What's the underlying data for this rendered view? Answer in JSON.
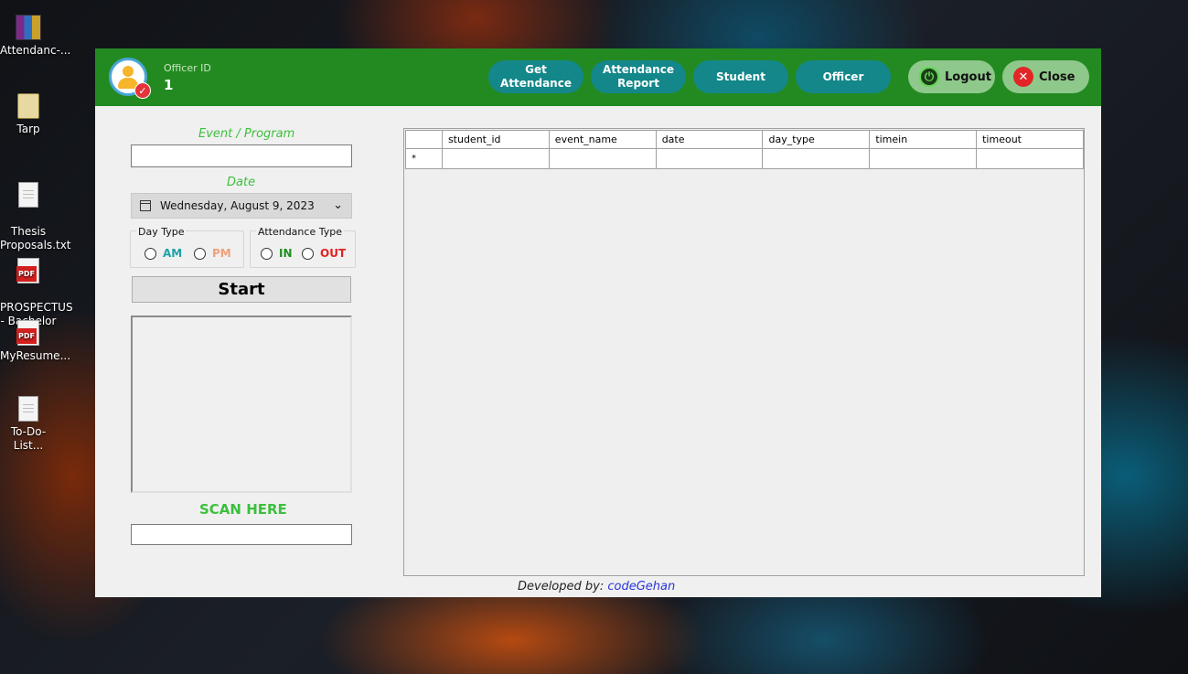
{
  "desktop": {
    "icons": [
      {
        "label": "Attendanc-...",
        "kind": "archive"
      },
      {
        "label": "Tarp",
        "kind": "folder"
      },
      {
        "label": "Thesis\nProposals.txt",
        "kind": "text"
      },
      {
        "label": "PROSPECTUS\n- Bachelor ...",
        "kind": "pdf"
      },
      {
        "label": "MyResume...",
        "kind": "pdf"
      },
      {
        "label": "To-Do-List...",
        "kind": "text"
      }
    ]
  },
  "header": {
    "officer_label": "Officer ID",
    "officer_value": "1",
    "nav": {
      "get_attendance": "Get\nAttendance",
      "attendance_report": "Attendance\nReport",
      "student": "Student",
      "officer": "Officer"
    },
    "logout": "Logout",
    "close": "Close"
  },
  "form": {
    "event_label": "Event / Program",
    "event_value": "",
    "date_label": "Date",
    "date_value": "Wednesday, August 9, 2023",
    "day_type": {
      "legend": "Day Type",
      "am": "AM",
      "pm": "PM",
      "am_color": "#1fa3a8",
      "pm_color": "#f0a07a"
    },
    "attendance_type": {
      "legend": "Attendance Type",
      "in": "IN",
      "out": "OUT",
      "in_color": "#1e8f1e",
      "out_color": "#e52020"
    },
    "start_label": "Start",
    "scan_label": "SCAN HERE",
    "scan_value": ""
  },
  "grid": {
    "columns": [
      "student_id",
      "event_name",
      "date",
      "day_type",
      "timein",
      "timeout"
    ],
    "new_row_marker": "*"
  },
  "footer": {
    "prefix": "Developed by:",
    "brand": "codeGehan"
  },
  "colors": {
    "header_bg": "#238a22",
    "nav_btn": "#13878a",
    "pill_btn": "#8ec88a",
    "label_green": "#3dbf3d"
  }
}
